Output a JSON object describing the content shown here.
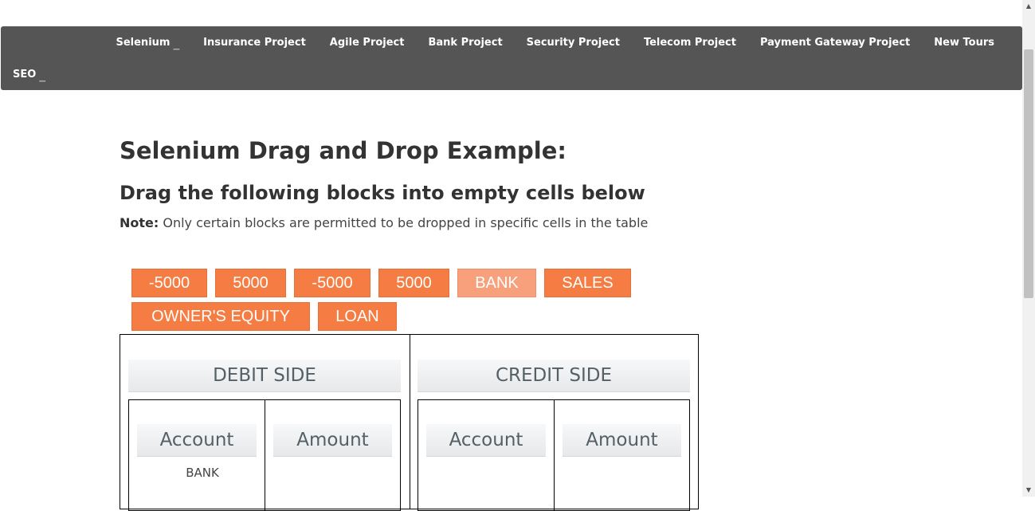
{
  "nav": {
    "row1": [
      "Selenium",
      "Insurance Project",
      "Agile Project",
      "Bank Project",
      "Security Project",
      "Telecom Project",
      "Payment Gateway Project",
      "New Tours"
    ],
    "row2": [
      "SEO"
    ]
  },
  "page": {
    "title": "Selenium Drag and Drop Example:",
    "subtitle": "Drag the following blocks into empty cells below",
    "note_label": "Note:",
    "note_text": " Only certain blocks are permitted to be dropped in specific cells in the table"
  },
  "blocks": [
    "-5000",
    "5000",
    "-5000",
    "5000",
    "BANK",
    "SALES",
    "OWNER'S EQUITY",
    "LOAN"
  ],
  "debit": {
    "header": "DEBIT SIDE",
    "account_header": "Account",
    "amount_header": "Amount",
    "account_value": "BANK"
  },
  "credit": {
    "header": "CREDIT SIDE",
    "account_header": "Account",
    "amount_header": "Amount"
  },
  "colors": {
    "navbar": "#555555",
    "block": "#f57c42",
    "block_used": "#f7a07b"
  }
}
